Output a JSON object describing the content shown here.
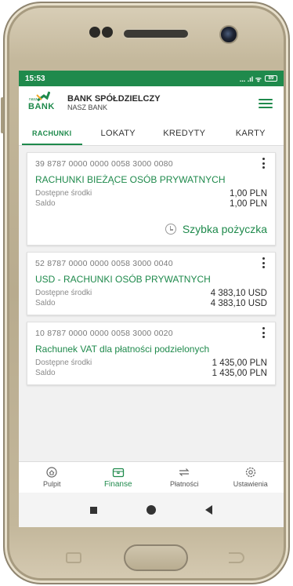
{
  "status_bar": {
    "time": "15:53",
    "icons": "... .ıl ᯤ",
    "battery": "89"
  },
  "app": {
    "logo_small": "nasz",
    "logo_text": "BANK",
    "brand_title": "BANK SPÓŁDZIELCZY",
    "brand_subtitle": "NASZ BANK",
    "menu_icon": "hamburger-icon"
  },
  "tabs": [
    {
      "label": "RACHUNKI",
      "active": true
    },
    {
      "label": "LOKATY",
      "active": false
    },
    {
      "label": "KREDYTY",
      "active": false
    },
    {
      "label": "KARTY",
      "active": false
    }
  ],
  "accounts": [
    {
      "number": "39 8787 0000 0000 0058 3000 0080",
      "name": "RACHUNKI BIEŻĄCE OSÓB PRYWATNYCH",
      "available_label": "Dostępne środki",
      "available": "1,00 PLN",
      "balance_label": "Saldo",
      "balance": "1,00 PLN",
      "quick_loan": "Szybka pożyczka"
    },
    {
      "number": "52 8787 0000 0000 0058 3000 0040",
      "name": "USD - RACHUNKI OSÓB PRYWATNYCH",
      "available_label": "Dostępne środki",
      "available": "4 383,10 USD",
      "balance_label": "Saldo",
      "balance": "4 383,10 USD"
    },
    {
      "number": "10 8787 0000 0000 0058 3000 0020",
      "name": "Rachunek VAT dla płatności podzielonych",
      "available_label": "Dostępne środki",
      "available": "1 435,00 PLN",
      "balance_label": "Saldo",
      "balance": "1 435,00 PLN"
    }
  ],
  "bottom_nav": [
    {
      "label": "Pulpit",
      "icon": "home-icon",
      "active": false
    },
    {
      "label": "Finanse",
      "icon": "wallet-icon",
      "active": true
    },
    {
      "label": "Płatności",
      "icon": "transfer-arrows-icon",
      "active": false
    },
    {
      "label": "Ustawienia",
      "icon": "gear-icon",
      "active": false
    }
  ],
  "colors": {
    "brand_green": "#1f8a4c",
    "screen_bg": "#f1f1f1"
  }
}
